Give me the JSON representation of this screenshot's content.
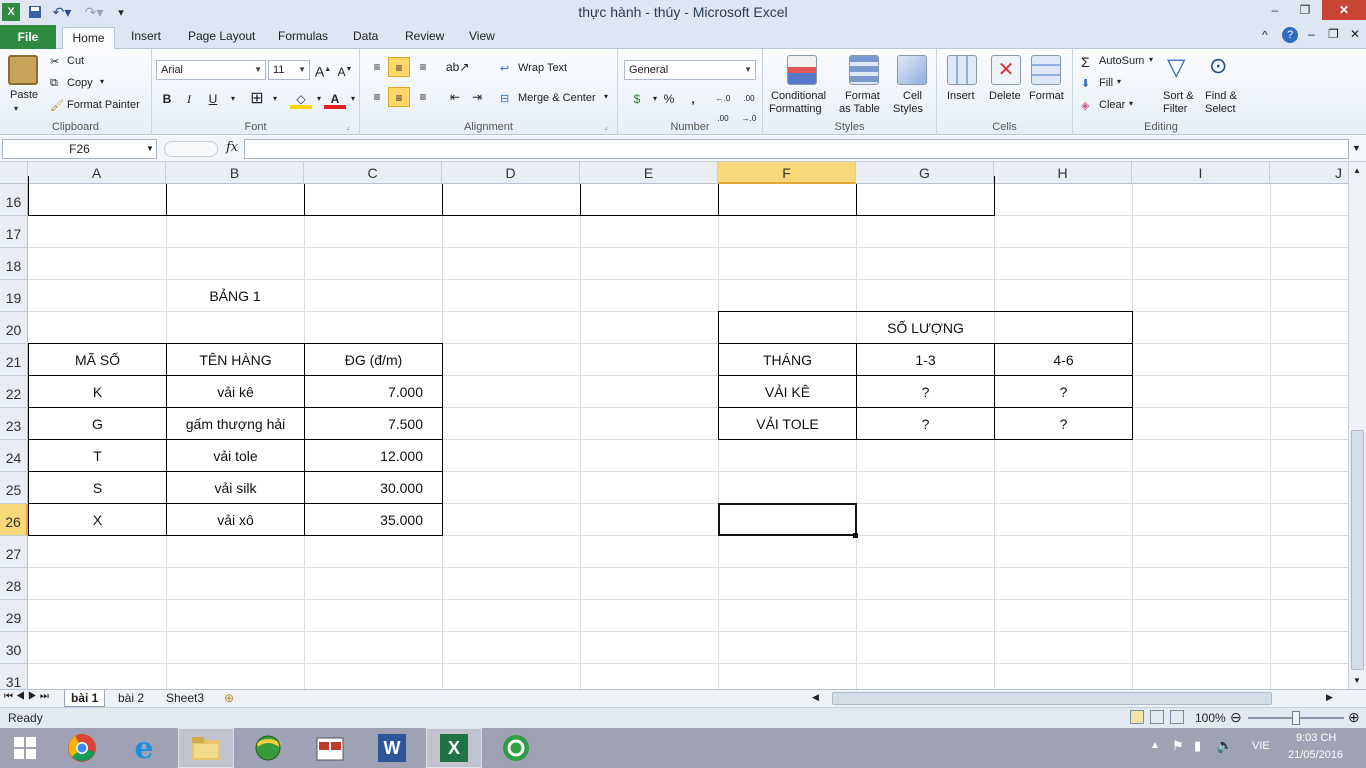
{
  "window": {
    "title": "thực hành - thúy - Microsoft Excel",
    "minimize": "–",
    "restore": "❐",
    "close": "✕"
  },
  "ribbon_tabs": [
    "File",
    "Home",
    "Insert",
    "Page Layout",
    "Formulas",
    "Data",
    "Review",
    "View"
  ],
  "clipboard": {
    "paste": "Paste",
    "cut": "Cut",
    "copy": "Copy",
    "format_painter": "Format Painter",
    "label": "Clipboard"
  },
  "font": {
    "name": "Arial",
    "size": "11",
    "bold": "B",
    "italic": "I",
    "underline": "U",
    "label": "Font"
  },
  "alignment": {
    "wrap_text": "Wrap Text",
    "merge_center": "Merge & Center",
    "label": "Alignment"
  },
  "number": {
    "format": "General",
    "percent": "%",
    "comma": ",",
    "inc_dec": "←.0 .00",
    "dec_dec": ".00 →.0",
    "label": "Number"
  },
  "styles": {
    "conditional": "Conditional",
    "conditional2": "Formatting",
    "format_table": "Format",
    "format_table2": "as Table",
    "cell_styles": "Cell",
    "cell_styles2": "Styles",
    "label": "Styles"
  },
  "cells": {
    "insert": "Insert",
    "delete": "Delete",
    "format": "Format",
    "label": "Cells"
  },
  "editing": {
    "autosum": "AutoSum",
    "fill": "Fill",
    "clear": "Clear",
    "sort": "Sort &",
    "sort2": "Filter",
    "find": "Find &",
    "find2": "Select",
    "label": "Editing"
  },
  "formula_bar": {
    "name_box": "F26",
    "fx": "fx",
    "formula": ""
  },
  "columns": [
    "A",
    "B",
    "C",
    "D",
    "E",
    "F",
    "G",
    "H",
    "I",
    "J"
  ],
  "rows": [
    "16",
    "17",
    "18",
    "19",
    "20",
    "21",
    "22",
    "23",
    "24",
    "25",
    "26",
    "27",
    "28",
    "29",
    "30",
    "31"
  ],
  "sheet": {
    "bang1_title": "BẢNG 1",
    "table1_headers": [
      "MÃ SỐ",
      "TÊN HÀNG",
      "ĐG (đ/m)"
    ],
    "table1_rows": [
      [
        "K",
        "vải kê",
        "7.000"
      ],
      [
        "G",
        "gấm thượng hải",
        "7.500"
      ],
      [
        "T",
        "vải tole",
        "12.000"
      ],
      [
        "S",
        "vải silk",
        "30.000"
      ],
      [
        "X",
        "vải xô",
        "35.000"
      ]
    ],
    "table2_title": "SỐ LƯỢNG",
    "table2_headers": [
      "THÁNG",
      "1-3",
      "4-6"
    ],
    "table2_rows": [
      [
        "VẢI KÊ",
        "?",
        "?"
      ],
      [
        "VẢI TOLE",
        "?",
        "?"
      ]
    ]
  },
  "sheet_tabs": [
    "bài 1",
    "bài 2",
    "Sheet3"
  ],
  "status": {
    "ready": "Ready",
    "zoom": "100%"
  },
  "taskbar": {
    "lang": "VIE",
    "time": "9:03 CH",
    "date": "21/05/2016"
  }
}
